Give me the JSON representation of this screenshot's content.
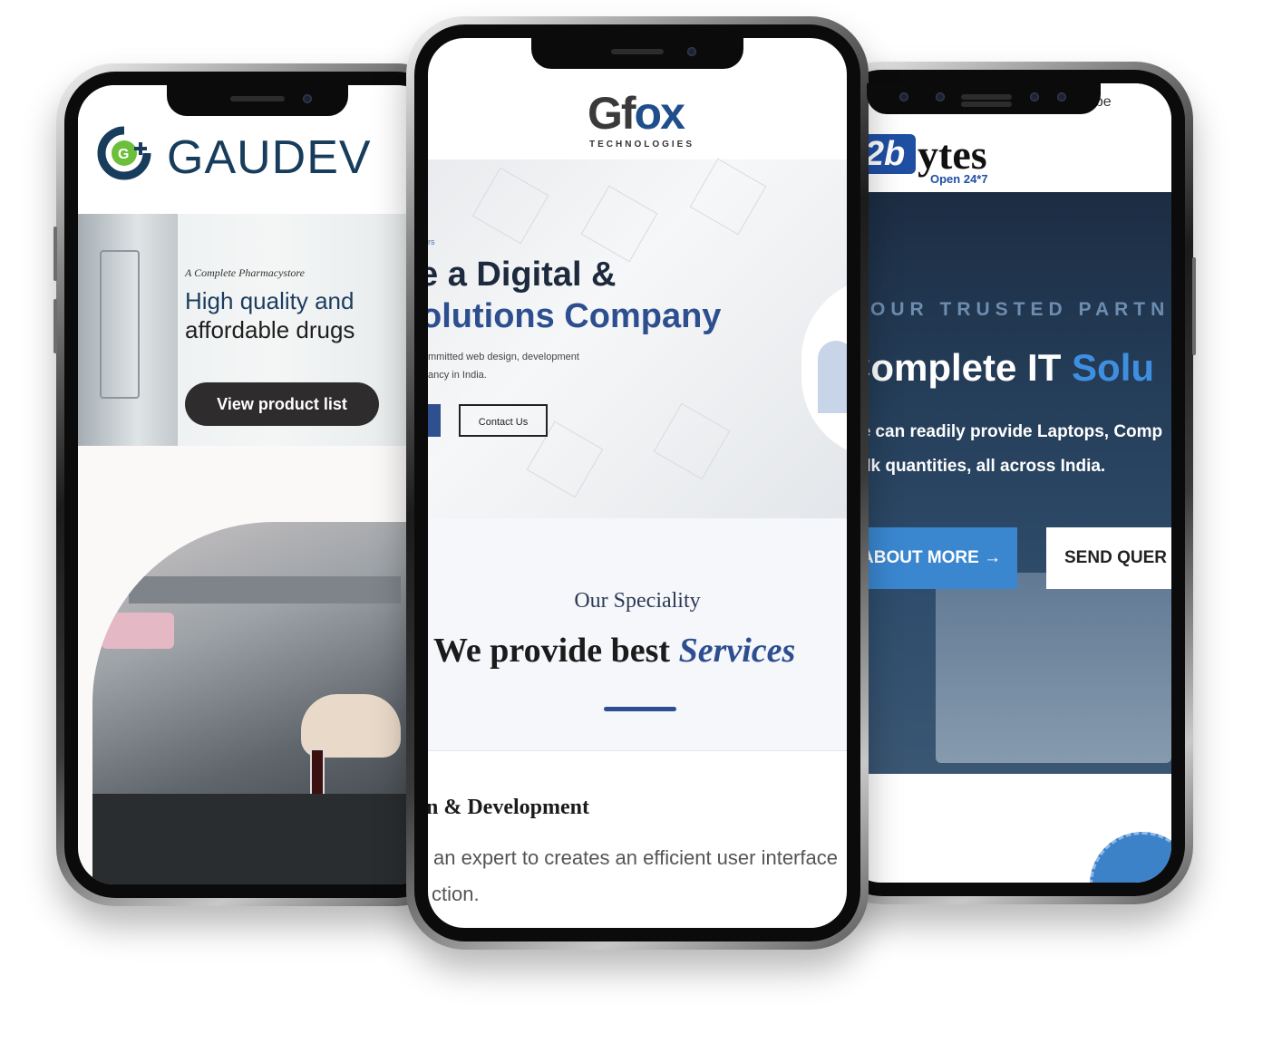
{
  "left_phone": {
    "brand": "GAUDEV",
    "hero": {
      "tagline": "A Complete Pharmacystore",
      "headline_line1": "High quality and",
      "headline_line2": "affordable drugs",
      "cta_label": "View product list"
    },
    "icons": [
      "gaudev-logo-icon"
    ]
  },
  "center_phone": {
    "brand": {
      "logo_text_g": "Gf",
      "logo_text_ox": "ox",
      "logo_subtext": "TECHNOLOGIES"
    },
    "hero": {
      "kicker": "rs",
      "headline_line1": "e a Digital &",
      "headline_line2": "olutions Company",
      "desc_line1": "mmitted web design, development",
      "desc_line2": "ancy in India.",
      "contact_label": "Contact Us"
    },
    "speciality": {
      "kicker": "Our Speciality",
      "title_plain": "We provide best ",
      "title_italic": "Services"
    },
    "service": {
      "title": "gn & Development",
      "body_line1": "an expert to creates an efficient user interface",
      "body_line2": "ction."
    }
  },
  "right_phone": {
    "browser_tab": {
      "youtube_label": "ouTube"
    },
    "brand": {
      "logo_prefix": "2b",
      "logo_rest": "ytes",
      "logo_sub": "Open 24*7"
    },
    "hero": {
      "kicker": "YOUR TRUSTED PARTN",
      "headline_plain": "Complete IT ",
      "headline_accent": "Solu",
      "desc_line1": "We can readily provide Laptops, Comp",
      "desc_line2": "bulk quantities, all across India.",
      "about_label": "ABOUT MORE →",
      "query_label": "SEND QUER"
    }
  },
  "colors": {
    "gaudev_navy": "#173c5c",
    "gaudev_green": "#6cbf3a",
    "gfox_blue": "#2d4f8f",
    "bytes_blue": "#3a87d0",
    "bytes_dark": "#1c2d43"
  }
}
